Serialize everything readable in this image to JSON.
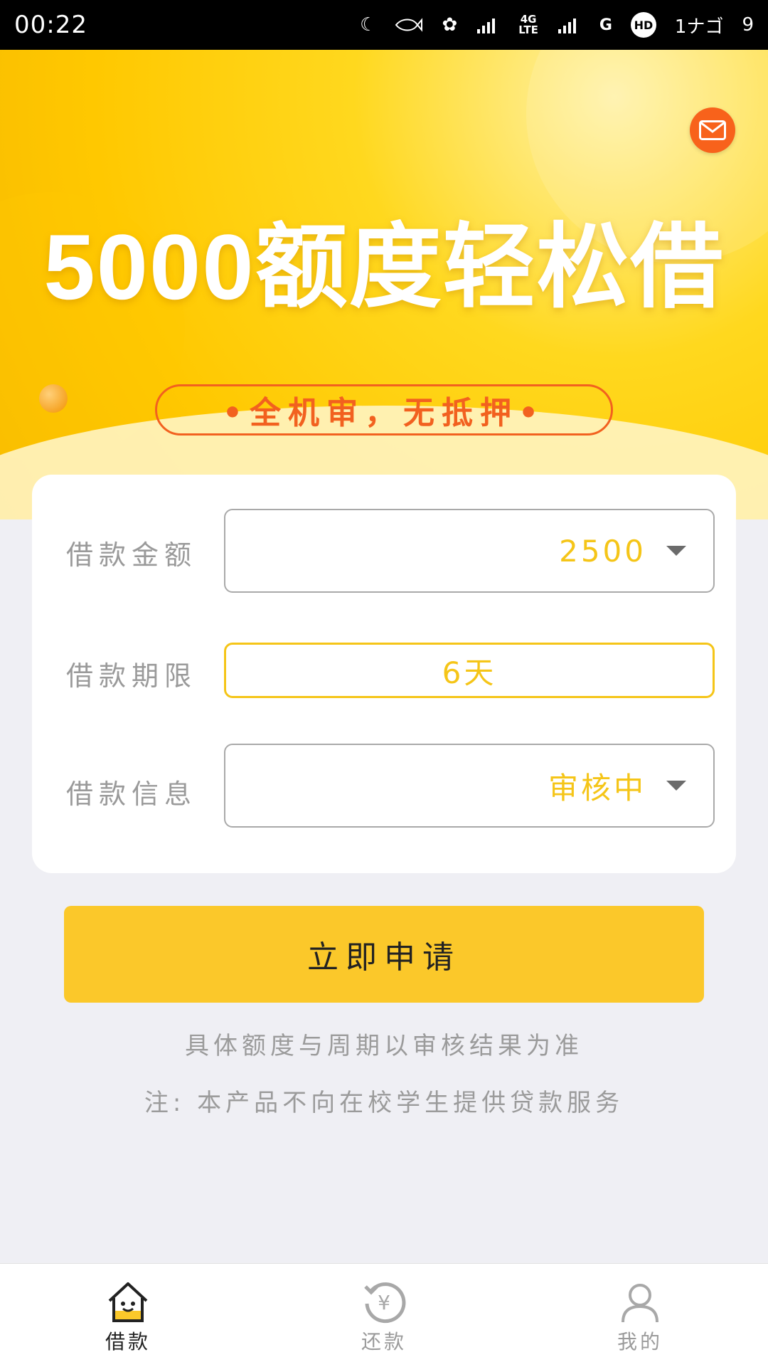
{
  "status_bar": {
    "time": "00:22",
    "icons": [
      "moon-icon",
      "fish-icon",
      "clover-upload-icon",
      "signal-1-icon",
      "4g-lte-icon",
      "signal-2-icon",
      "g-icon",
      "hd-icon",
      "battery-text",
      "battery-icon"
    ],
    "lte_top": "4G",
    "lte_bottom": "LTE",
    "g_label": "G",
    "hd_label": "HD",
    "battery_text": "1ナゴ",
    "extra": "9"
  },
  "banner": {
    "headline": "5000额度轻松借",
    "subline": "•全机审，无抵押•"
  },
  "form": {
    "amount": {
      "label": "借款金额",
      "value": "2500"
    },
    "term": {
      "label": "借款期限",
      "value": "6天"
    },
    "info": {
      "label": "借款信息",
      "value": "审核中"
    }
  },
  "apply_button": {
    "label": "立即申请"
  },
  "notes": {
    "line1": "具体额度与周期以审核结果为准",
    "line2": "注:  本产品不向在校学生提供贷款服务"
  },
  "tabs": [
    {
      "label": "借款",
      "icon": "home-icon",
      "active": true
    },
    {
      "label": "还款",
      "icon": "repay-yen-icon",
      "active": false
    },
    {
      "label": "我的",
      "icon": "user-icon",
      "active": false
    }
  ],
  "colors": {
    "accent": "#fbc82a",
    "value_yellow": "#f5c518",
    "pill_orange": "#f2611f",
    "mail_orange": "#f8621b"
  }
}
